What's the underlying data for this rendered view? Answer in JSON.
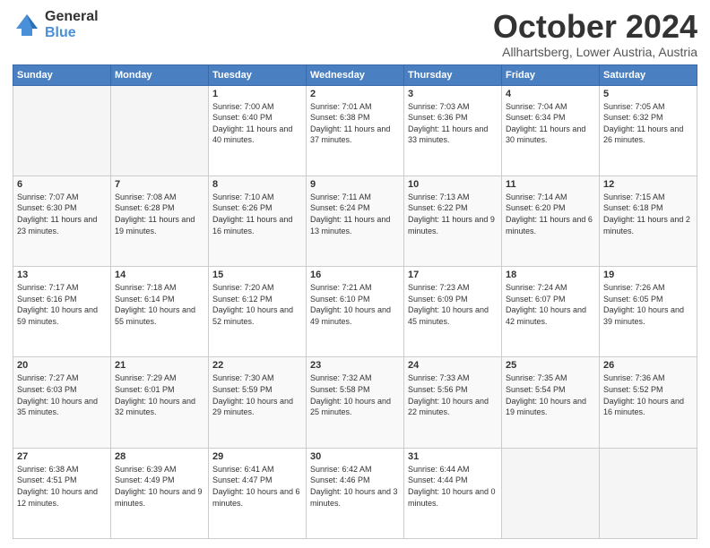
{
  "logo": {
    "general": "General",
    "blue": "Blue"
  },
  "header": {
    "month": "October 2024",
    "location": "Allhartsberg, Lower Austria, Austria"
  },
  "weekdays": [
    "Sunday",
    "Monday",
    "Tuesday",
    "Wednesday",
    "Thursday",
    "Friday",
    "Saturday"
  ],
  "weeks": [
    [
      {
        "day": null
      },
      {
        "day": null
      },
      {
        "day": "1",
        "sunrise": "Sunrise: 7:00 AM",
        "sunset": "Sunset: 6:40 PM",
        "daylight": "Daylight: 11 hours and 40 minutes."
      },
      {
        "day": "2",
        "sunrise": "Sunrise: 7:01 AM",
        "sunset": "Sunset: 6:38 PM",
        "daylight": "Daylight: 11 hours and 37 minutes."
      },
      {
        "day": "3",
        "sunrise": "Sunrise: 7:03 AM",
        "sunset": "Sunset: 6:36 PM",
        "daylight": "Daylight: 11 hours and 33 minutes."
      },
      {
        "day": "4",
        "sunrise": "Sunrise: 7:04 AM",
        "sunset": "Sunset: 6:34 PM",
        "daylight": "Daylight: 11 hours and 30 minutes."
      },
      {
        "day": "5",
        "sunrise": "Sunrise: 7:05 AM",
        "sunset": "Sunset: 6:32 PM",
        "daylight": "Daylight: 11 hours and 26 minutes."
      }
    ],
    [
      {
        "day": "6",
        "sunrise": "Sunrise: 7:07 AM",
        "sunset": "Sunset: 6:30 PM",
        "daylight": "Daylight: 11 hours and 23 minutes."
      },
      {
        "day": "7",
        "sunrise": "Sunrise: 7:08 AM",
        "sunset": "Sunset: 6:28 PM",
        "daylight": "Daylight: 11 hours and 19 minutes."
      },
      {
        "day": "8",
        "sunrise": "Sunrise: 7:10 AM",
        "sunset": "Sunset: 6:26 PM",
        "daylight": "Daylight: 11 hours and 16 minutes."
      },
      {
        "day": "9",
        "sunrise": "Sunrise: 7:11 AM",
        "sunset": "Sunset: 6:24 PM",
        "daylight": "Daylight: 11 hours and 13 minutes."
      },
      {
        "day": "10",
        "sunrise": "Sunrise: 7:13 AM",
        "sunset": "Sunset: 6:22 PM",
        "daylight": "Daylight: 11 hours and 9 minutes."
      },
      {
        "day": "11",
        "sunrise": "Sunrise: 7:14 AM",
        "sunset": "Sunset: 6:20 PM",
        "daylight": "Daylight: 11 hours and 6 minutes."
      },
      {
        "day": "12",
        "sunrise": "Sunrise: 7:15 AM",
        "sunset": "Sunset: 6:18 PM",
        "daylight": "Daylight: 11 hours and 2 minutes."
      }
    ],
    [
      {
        "day": "13",
        "sunrise": "Sunrise: 7:17 AM",
        "sunset": "Sunset: 6:16 PM",
        "daylight": "Daylight: 10 hours and 59 minutes."
      },
      {
        "day": "14",
        "sunrise": "Sunrise: 7:18 AM",
        "sunset": "Sunset: 6:14 PM",
        "daylight": "Daylight: 10 hours and 55 minutes."
      },
      {
        "day": "15",
        "sunrise": "Sunrise: 7:20 AM",
        "sunset": "Sunset: 6:12 PM",
        "daylight": "Daylight: 10 hours and 52 minutes."
      },
      {
        "day": "16",
        "sunrise": "Sunrise: 7:21 AM",
        "sunset": "Sunset: 6:10 PM",
        "daylight": "Daylight: 10 hours and 49 minutes."
      },
      {
        "day": "17",
        "sunrise": "Sunrise: 7:23 AM",
        "sunset": "Sunset: 6:09 PM",
        "daylight": "Daylight: 10 hours and 45 minutes."
      },
      {
        "day": "18",
        "sunrise": "Sunrise: 7:24 AM",
        "sunset": "Sunset: 6:07 PM",
        "daylight": "Daylight: 10 hours and 42 minutes."
      },
      {
        "day": "19",
        "sunrise": "Sunrise: 7:26 AM",
        "sunset": "Sunset: 6:05 PM",
        "daylight": "Daylight: 10 hours and 39 minutes."
      }
    ],
    [
      {
        "day": "20",
        "sunrise": "Sunrise: 7:27 AM",
        "sunset": "Sunset: 6:03 PM",
        "daylight": "Daylight: 10 hours and 35 minutes."
      },
      {
        "day": "21",
        "sunrise": "Sunrise: 7:29 AM",
        "sunset": "Sunset: 6:01 PM",
        "daylight": "Daylight: 10 hours and 32 minutes."
      },
      {
        "day": "22",
        "sunrise": "Sunrise: 7:30 AM",
        "sunset": "Sunset: 5:59 PM",
        "daylight": "Daylight: 10 hours and 29 minutes."
      },
      {
        "day": "23",
        "sunrise": "Sunrise: 7:32 AM",
        "sunset": "Sunset: 5:58 PM",
        "daylight": "Daylight: 10 hours and 25 minutes."
      },
      {
        "day": "24",
        "sunrise": "Sunrise: 7:33 AM",
        "sunset": "Sunset: 5:56 PM",
        "daylight": "Daylight: 10 hours and 22 minutes."
      },
      {
        "day": "25",
        "sunrise": "Sunrise: 7:35 AM",
        "sunset": "Sunset: 5:54 PM",
        "daylight": "Daylight: 10 hours and 19 minutes."
      },
      {
        "day": "26",
        "sunrise": "Sunrise: 7:36 AM",
        "sunset": "Sunset: 5:52 PM",
        "daylight": "Daylight: 10 hours and 16 minutes."
      }
    ],
    [
      {
        "day": "27",
        "sunrise": "Sunrise: 6:38 AM",
        "sunset": "Sunset: 4:51 PM",
        "daylight": "Daylight: 10 hours and 12 minutes."
      },
      {
        "day": "28",
        "sunrise": "Sunrise: 6:39 AM",
        "sunset": "Sunset: 4:49 PM",
        "daylight": "Daylight: 10 hours and 9 minutes."
      },
      {
        "day": "29",
        "sunrise": "Sunrise: 6:41 AM",
        "sunset": "Sunset: 4:47 PM",
        "daylight": "Daylight: 10 hours and 6 minutes."
      },
      {
        "day": "30",
        "sunrise": "Sunrise: 6:42 AM",
        "sunset": "Sunset: 4:46 PM",
        "daylight": "Daylight: 10 hours and 3 minutes."
      },
      {
        "day": "31",
        "sunrise": "Sunrise: 6:44 AM",
        "sunset": "Sunset: 4:44 PM",
        "daylight": "Daylight: 10 hours and 0 minutes."
      },
      {
        "day": null
      },
      {
        "day": null
      }
    ]
  ]
}
